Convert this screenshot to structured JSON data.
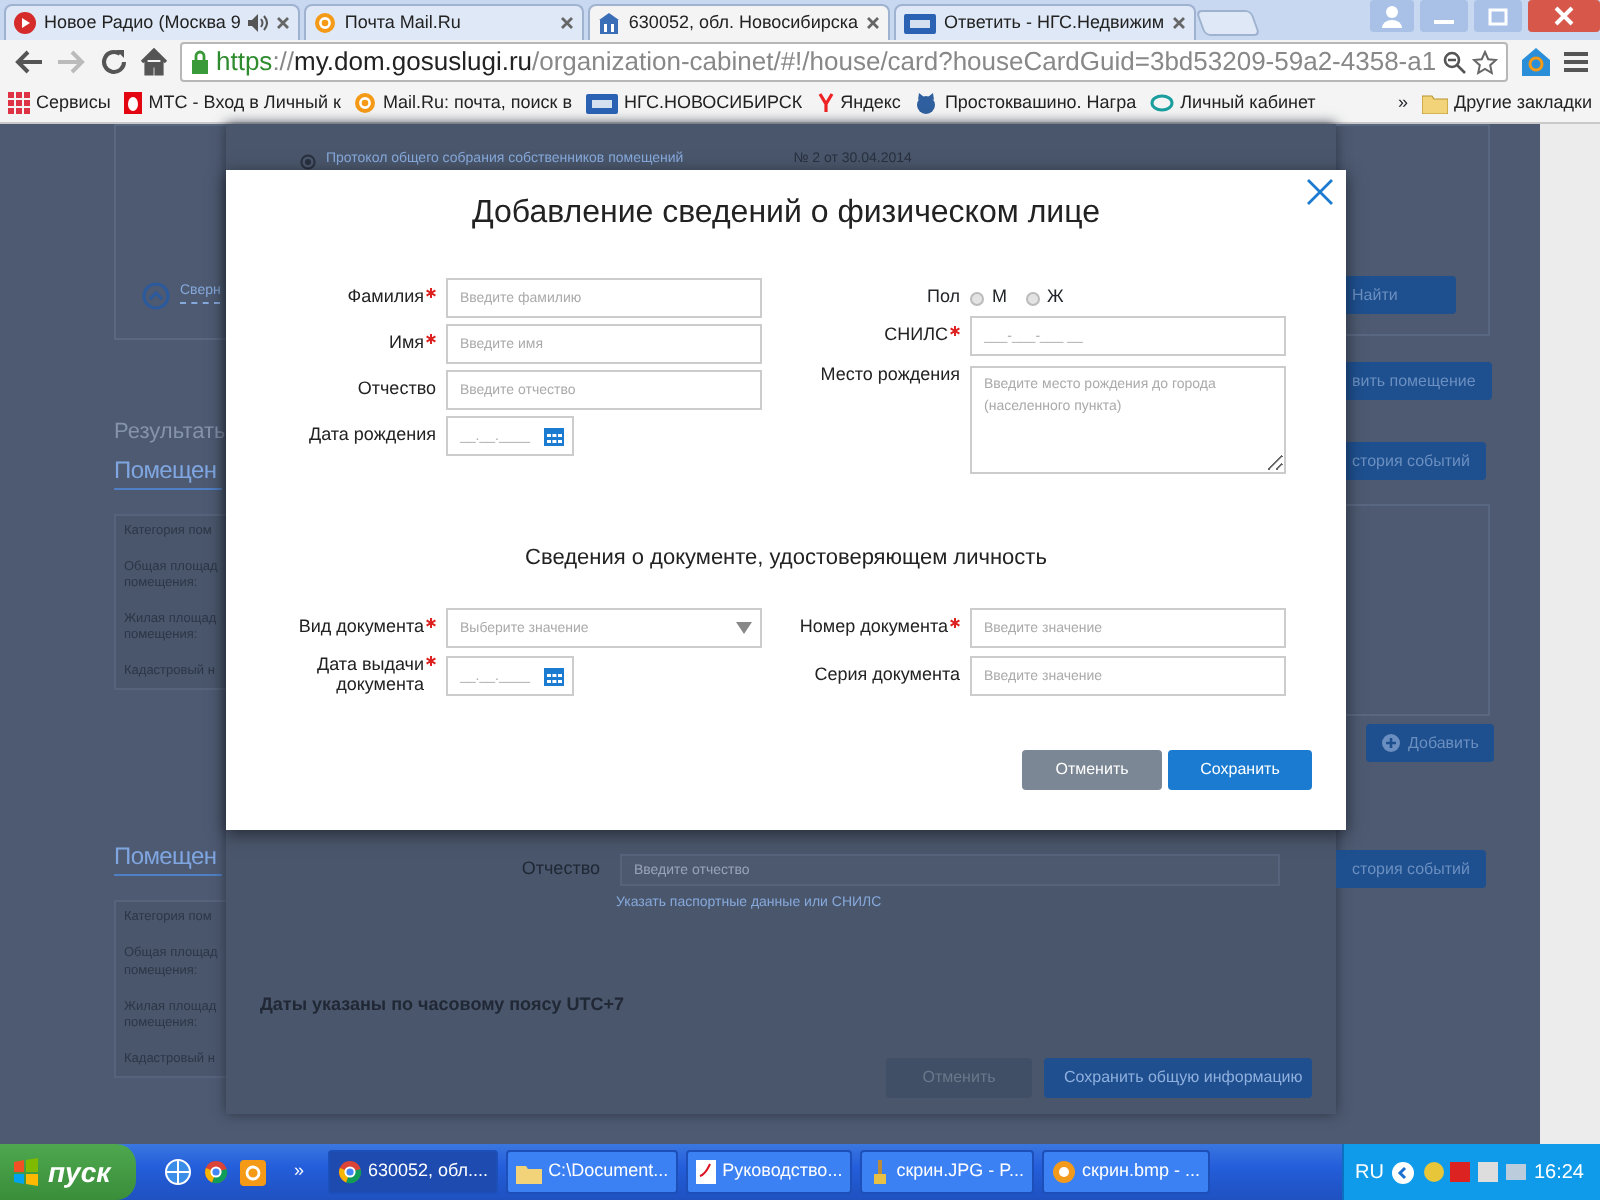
{
  "browser": {
    "tabs": [
      {
        "title": "Новое Радио (Москва 9",
        "audio": true,
        "selected": false
      },
      {
        "title": "Почта Mail.Ru",
        "audio": false,
        "selected": false
      },
      {
        "title": "630052, обл. Новосибирска",
        "audio": false,
        "selected": true
      },
      {
        "title": "Ответить - НГС.Недвижим",
        "audio": false,
        "selected": false
      }
    ],
    "address": {
      "scheme": "https",
      "separator": "://",
      "host": "my.dom.gosuslugi.ru",
      "path": "/organization-cabinet/#!/house/card?houseCardGuid=3bd53209-59a2-4358-a1"
    },
    "bookmarks": [
      {
        "label": "Сервисы"
      },
      {
        "label": "МТС - Вход в Личный к"
      },
      {
        "label": "Mail.Ru: почта, поиск в"
      },
      {
        "label": "НГС.НОВОСИБИРСК"
      },
      {
        "label": "Яндекс"
      },
      {
        "label": "Простоквашино. Награ"
      },
      {
        "label": "Личный кабинет"
      }
    ],
    "bookmarks_more": "»",
    "other_bookmarks": "Другие закладки"
  },
  "page": {
    "left": {
      "collapse_link": "Сверн",
      "results_label": "Результаты",
      "sections": [
        {
          "heading": "Помещен",
          "rows": [
            [
              "Категория пом"
            ],
            [
              "Общая площад",
              "помещения:"
            ],
            [
              "Жилая площад",
              "помещения:"
            ],
            [
              "Кадастровый н"
            ]
          ]
        },
        {
          "heading": "Помещен",
          "rows": [
            [
              "Категория пом"
            ],
            [
              "Общая площад",
              "помещения:"
            ],
            [
              "Жилая площад",
              "помещения:"
            ],
            [
              "Кадастровый н"
            ]
          ]
        }
      ]
    },
    "dialog": {
      "protocol": "Протокол общего собрания собственников помещений",
      "protocol_number": "№ 2 от 30.04.2014",
      "patronymic": {
        "label": "Отчество",
        "placeholder": "Введите отчество"
      },
      "link": "Указать паспортные данные или СНИЛС",
      "timezone_note": "Даты указаны по часовому поясу UTC+7",
      "buttons": [
        {
          "label": "Отменить",
          "kind": "secondary"
        },
        {
          "label": "Сохранить общую информацию",
          "kind": "primary"
        }
      ]
    },
    "right": {
      "buttons": [
        {
          "label": "Найти",
          "kind": "plain"
        },
        {
          "label": "вить помещение",
          "kind": "plain"
        },
        {
          "label": "стория событий",
          "kind": "plain"
        },
        {
          "label": "Добавить",
          "kind": "add"
        },
        {
          "label": "стория событий",
          "kind": "plain"
        }
      ]
    }
  },
  "modal": {
    "title": "Добавление сведений о физическом лице",
    "person_left": [
      {
        "label": "Фамилия",
        "required": true,
        "kind": "text",
        "placeholder": "Введите фамилию"
      },
      {
        "label": "Имя",
        "required": true,
        "kind": "text",
        "placeholder": "Введите имя"
      },
      {
        "label": "Отчество",
        "required": false,
        "kind": "text",
        "placeholder": "Введите отчество"
      },
      {
        "label": "Дата рождения",
        "required": false,
        "kind": "date",
        "placeholder": "__.__.____"
      }
    ],
    "gender": {
      "label": "Пол",
      "options": [
        {
          "label": "М",
          "selected": false
        },
        {
          "label": "Ж",
          "selected": false
        }
      ]
    },
    "person_right": [
      {
        "label": "СНИЛС",
        "required": true,
        "kind": "text",
        "placeholder": "___-___-___ __"
      },
      {
        "label": "Место рождения",
        "required": false,
        "kind": "textarea",
        "placeholder": "Введите место рождения до города (населенного пункта)"
      }
    ],
    "document_heading": "Сведения о документе, удостоверяющем личность",
    "document_left": [
      {
        "label": "Вид документа",
        "required": true,
        "kind": "select",
        "placeholder": "Выберите значение"
      },
      {
        "label": "Дата выдачи документа",
        "required": true,
        "kind": "date",
        "placeholder": "__.__.____"
      }
    ],
    "document_right": [
      {
        "label": "Номер документа",
        "required": true,
        "kind": "text",
        "placeholder": "Введите значение"
      },
      {
        "label": "Серия документа",
        "required": false,
        "kind": "text",
        "placeholder": "Введите значение"
      }
    ],
    "buttons": [
      {
        "label": "Отменить",
        "kind": "secondary"
      },
      {
        "label": "Сохранить",
        "kind": "primary"
      }
    ]
  },
  "taskbar": {
    "start": "пуск",
    "more": "»",
    "tasks": [
      {
        "label": "630052, обл....",
        "selected": true
      },
      {
        "label": "C:\\Document...",
        "selected": false
      },
      {
        "label": "Руководство...",
        "selected": false
      },
      {
        "label": "скрин.JPG - P...",
        "selected": false
      },
      {
        "label": "скрин.bmp - ...",
        "selected": false
      }
    ],
    "language": "RU",
    "clock": "16:24"
  }
}
